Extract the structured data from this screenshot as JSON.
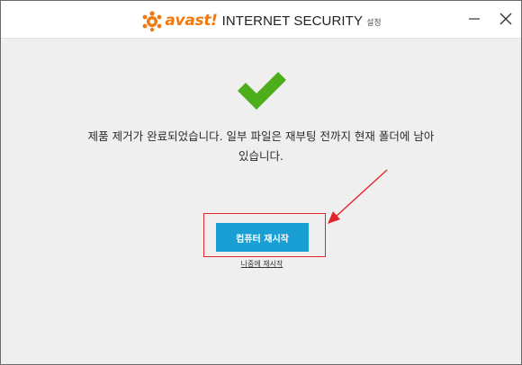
{
  "titlebar": {
    "brand": "avast!",
    "product": "INTERNET SECURITY",
    "subtitle": "설정",
    "logo_icon": "avast-logo-icon",
    "minimize_icon": "minimize-icon",
    "close_icon": "close-icon"
  },
  "main": {
    "status_icon": "checkmark-icon",
    "message_line1": "제품 제거가 완료되었습니다. 일부 파일은 재부팅 전까지 현재 폴더에 남아",
    "message_line2": "있습니다.",
    "restart_button": "컴퓨터 재시작",
    "later_link": "나중에 재시작"
  },
  "annotation": {
    "highlight_icon": "red-highlight-box",
    "arrow_icon": "red-arrow-icon"
  },
  "colors": {
    "brand_orange": "#f07a10",
    "check_green": "#4cae1a",
    "button_blue": "#1a9fd4",
    "annotation_red": "#e0262b",
    "background": "#efefef"
  }
}
